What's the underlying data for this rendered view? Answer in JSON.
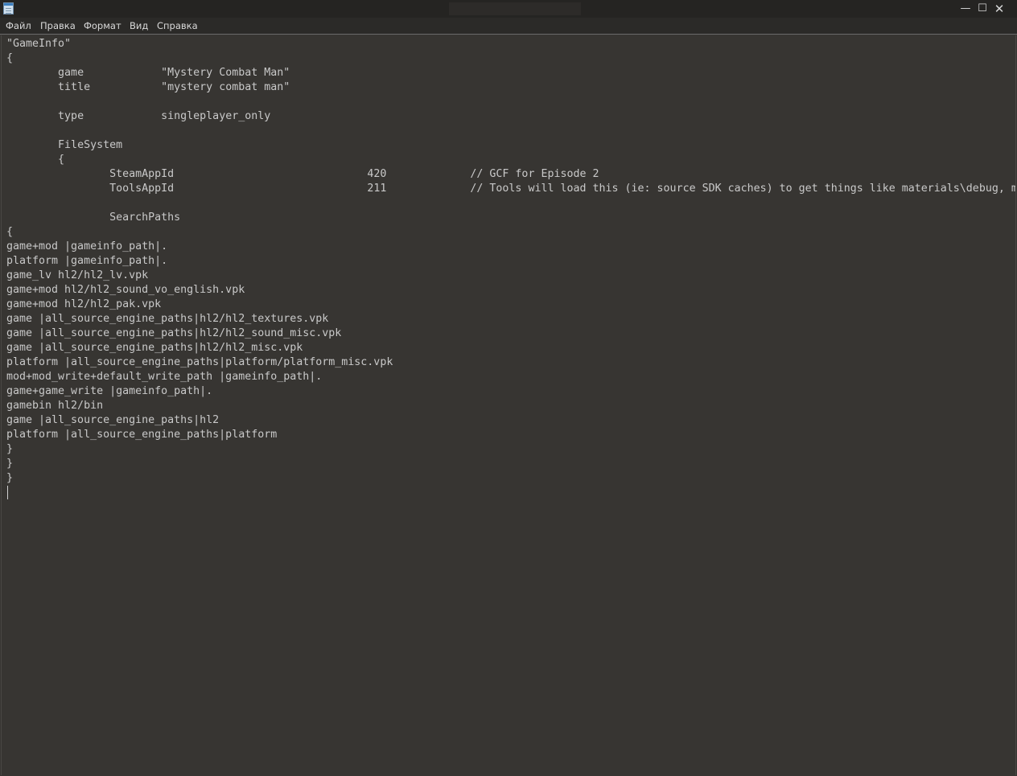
{
  "window": {
    "title": ""
  },
  "menu": {
    "file": "Файл",
    "edit": "Правка",
    "format": "Формат",
    "view": "Вид",
    "help": "Справка"
  },
  "controls": {
    "minimize": "—",
    "maximize": "☐",
    "close": "✕"
  },
  "editor": {
    "content": "\"GameInfo\"\n{\n\tgame\t\t\"Mystery Combat Man\"\n\ttitle\t\t\"mystery combat man\"\n\n\ttype\t\tsingleplayer_only\n\n\tFileSystem\n\t{\n\t\tSteamAppId\t\t\t\t420\t\t// GCF for Episode 2\n\t\tToolsAppId\t\t\t\t211\t\t// Tools will load this (ie: source SDK caches) to get things like materials\\debug, materials\\editor, etc.\n\n\t\tSearchPaths\n{\ngame+mod |gameinfo_path|.\nplatform |gameinfo_path|.\ngame_lv hl2/hl2_lv.vpk\ngame+mod hl2/hl2_sound_vo_english.vpk\ngame+mod hl2/hl2_pak.vpk\ngame |all_source_engine_paths|hl2/hl2_textures.vpk\ngame |all_source_engine_paths|hl2/hl2_sound_misc.vpk\ngame |all_source_engine_paths|hl2/hl2_misc.vpk\nplatform |all_source_engine_paths|platform/platform_misc.vpk\nmod+mod_write+default_write_path |gameinfo_path|.\ngame+game_write |gameinfo_path|.\ngamebin hl2/bin\ngame |all_source_engine_paths|hl2\nplatform |all_source_engine_paths|platform\n}\n}\n}\n"
  },
  "colors": {
    "background": "#373532",
    "titlebar": "#252422",
    "menubar": "#2b2a28",
    "text": "#c9c9c9"
  }
}
